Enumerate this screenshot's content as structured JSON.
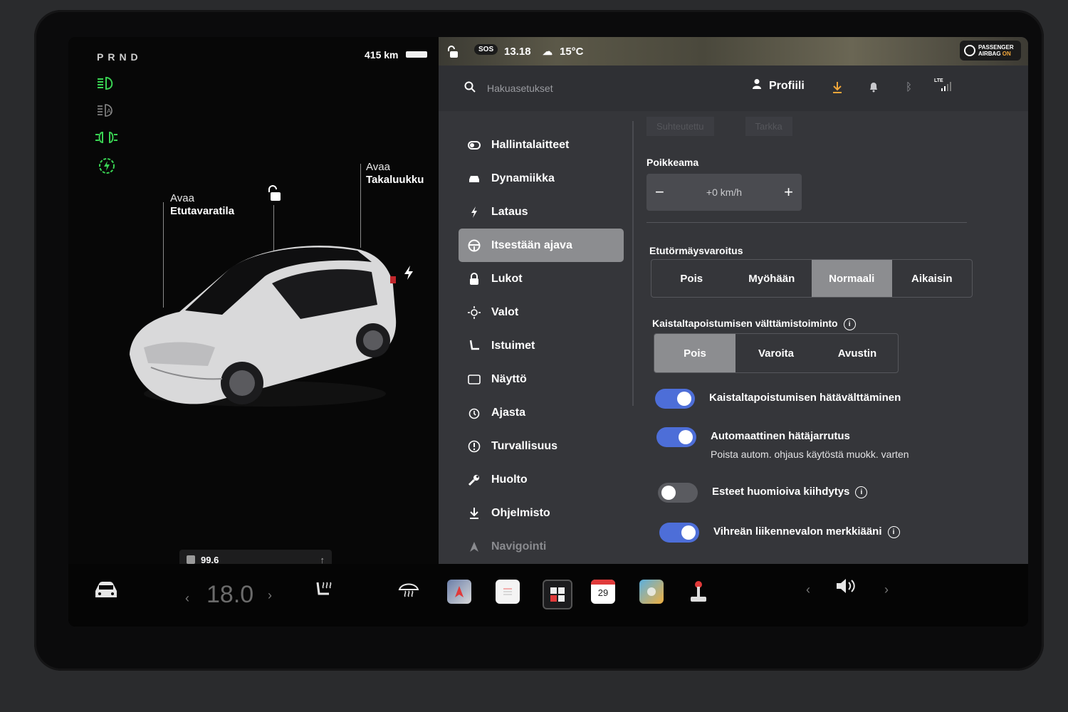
{
  "left": {
    "gear": "PRND",
    "range": "415 km",
    "labels": {
      "frunk_line1": "Avaa",
      "frunk_line2": "Etutavaratila",
      "trunk_line1": "Avaa",
      "trunk_line2": "Takaluukku"
    },
    "odometer": "99.6",
    "telltales": [
      "low-beam-icon",
      "auto-high-beam-icon",
      "parking-lights-icon",
      "charge-port-icon"
    ],
    "telltale_color": "#39d353"
  },
  "status": {
    "sos": "SOS",
    "time": "13.18",
    "temperature": "15°C",
    "airbag_line1": "PASSENGER",
    "airbag_line2": "AIRBAG",
    "airbag_state": "ON"
  },
  "topbar": {
    "search_placeholder": "Hakuasetukset",
    "profile_label": "Profiili",
    "lte": "LTE"
  },
  "nav": {
    "items": [
      {
        "label": "Hallintalaitteet",
        "icon": "toggle-icon"
      },
      {
        "label": "Dynamiikka",
        "icon": "car-icon"
      },
      {
        "label": "Lataus",
        "icon": "bolt-icon"
      },
      {
        "label": "Itsestään ajava",
        "icon": "steering-wheel-icon",
        "active": true
      },
      {
        "label": "Lukot",
        "icon": "lock-icon"
      },
      {
        "label": "Valot",
        "icon": "sun-icon"
      },
      {
        "label": "Istuimet",
        "icon": "seat-icon"
      },
      {
        "label": "Näyttö",
        "icon": "display-icon"
      },
      {
        "label": "Ajasta",
        "icon": "alarm-clock-icon"
      },
      {
        "label": "Turvallisuus",
        "icon": "alert-icon"
      },
      {
        "label": "Huolto",
        "icon": "wrench-icon"
      },
      {
        "label": "Ohjelmisto",
        "icon": "download-icon"
      },
      {
        "label": "Navigointi",
        "icon": "navigation-icon"
      }
    ]
  },
  "content": {
    "faint_tabs": [
      "Suhteutettu",
      "Tarkka"
    ],
    "offset_title": "Poikkeama",
    "offset_value": "+0 km/h",
    "minus": "−",
    "plus": "+",
    "fcw_title": "Etutörmäysvaroitus",
    "fcw_options": [
      "Pois",
      "Myöhään",
      "Normaali",
      "Aikaisin"
    ],
    "fcw_selected": "Normaali",
    "lane_title": "Kaistaltapoistumisen välttämistoiminto",
    "lane_options": [
      "Pois",
      "Varoita",
      "Avustin"
    ],
    "lane_selected": "Pois",
    "toggles": [
      {
        "label": "Kaistaltapoistumisen hätävälttäminen",
        "on": true
      },
      {
        "label": "Automaattinen hätäjarrutus",
        "sub": "Poista autom. ohjaus käytöstä muokk. varten",
        "on": true
      },
      {
        "label": "Esteet huomioiva kiihdytys",
        "on": false,
        "info": true
      },
      {
        "label": "Vihreän liikennevalon merkkiääni",
        "on": true,
        "info": true
      }
    ],
    "accent_color": "#4d6ed8"
  },
  "dock": {
    "temperature": "18.0",
    "calendar_day": "29"
  }
}
